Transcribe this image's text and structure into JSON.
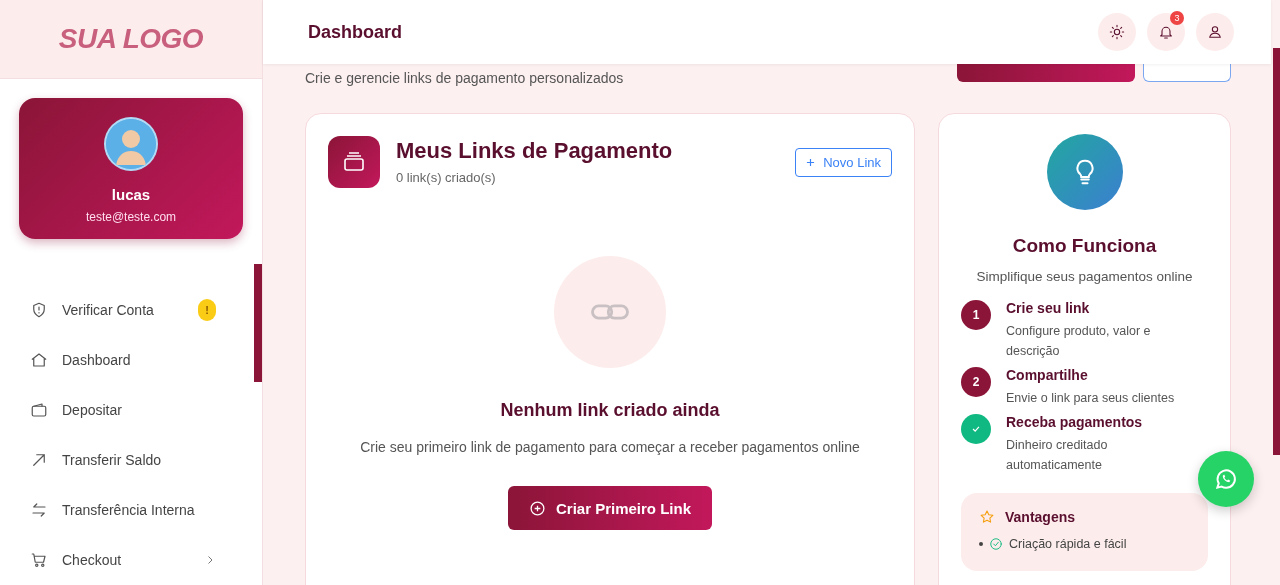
{
  "logo": "SUA LOGO",
  "profile": {
    "name": "lucas",
    "email": "teste@teste.com"
  },
  "sidebar": {
    "items": [
      {
        "label": "Verificar Conta",
        "badge": "!",
        "has_submenu": false
      },
      {
        "label": "Dashboard",
        "has_submenu": false
      },
      {
        "label": "Depositar",
        "has_submenu": false
      },
      {
        "label": "Transferir Saldo",
        "has_submenu": false
      },
      {
        "label": "Transferência Interna",
        "has_submenu": false
      },
      {
        "label": "Checkout",
        "has_submenu": true
      }
    ]
  },
  "header": {
    "title": "Dashboard",
    "notification_count": "3"
  },
  "page": {
    "subtitle": "Crie e gerencie links de pagamento personalizados"
  },
  "links_card": {
    "title": "Meus Links de Pagamento",
    "count": "0 link(s) criado(s)",
    "new_button": "Novo Link",
    "empty_title": "Nenhum link criado ainda",
    "empty_text": "Crie seu primeiro link de pagamento para começar a receber pagamentos online",
    "create_button": "Criar Primeiro Link"
  },
  "how_card": {
    "title": "Como Funciona",
    "subtitle": "Simplifique seus pagamentos online",
    "steps": [
      {
        "number": "1",
        "done": false,
        "title": "Crie seu link",
        "text": "Configure produto, valor e descrição"
      },
      {
        "number": "2",
        "done": false,
        "title": "Compartilhe",
        "text": "Envie o link para seus clientes"
      },
      {
        "done": true,
        "title": "Receba pagamentos",
        "text": "Dinheiro creditado automaticamente"
      }
    ],
    "advantages_title": "Vantagens",
    "advantages": [
      "Criação rápida e fácil"
    ]
  }
}
